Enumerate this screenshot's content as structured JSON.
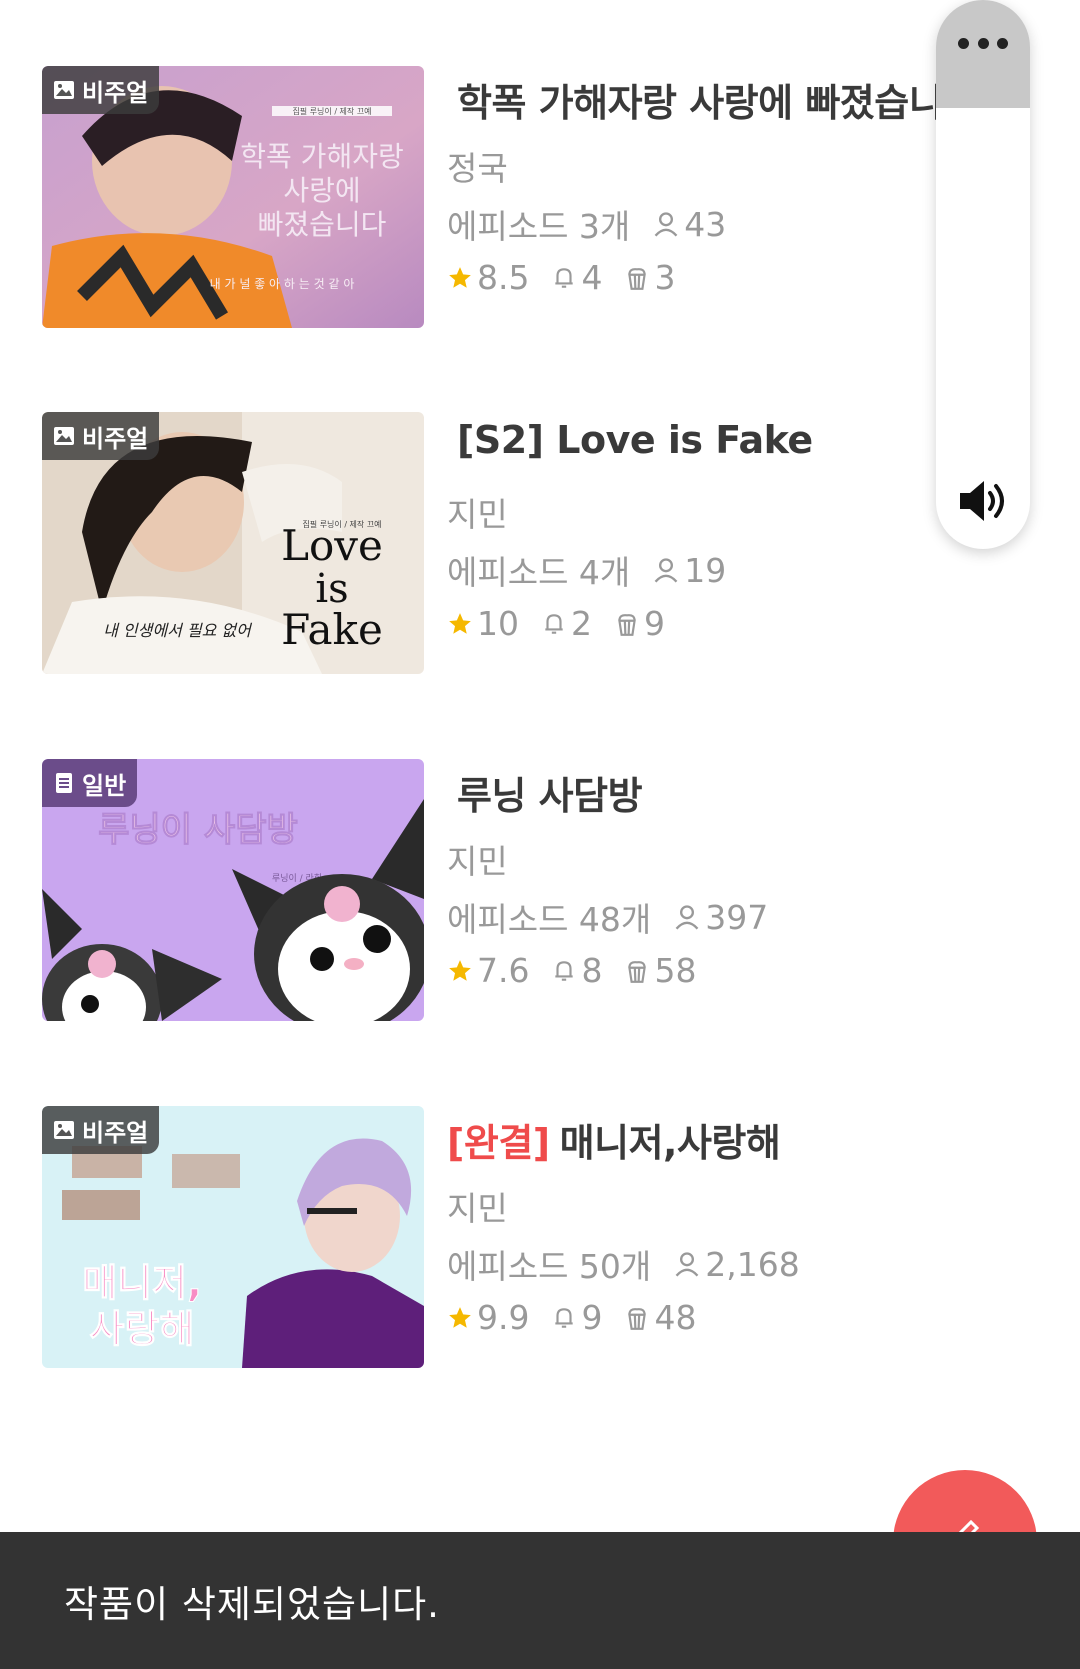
{
  "works": [
    {
      "type_badge": "비주얼",
      "tag": "",
      "title": "학폭 가해자랑 사랑에 빠졌습니다",
      "author": "정국",
      "episodes": "에피소드 3개",
      "readers": "43",
      "rating": "8.5",
      "subscribers": "4",
      "gifts": "3",
      "cover": {
        "small_line": "집필 루닝이 / 제작 끄예",
        "line1": "학폭 가해자랑",
        "line2": "사랑에",
        "line3": "빠졌습니다",
        "footer": "내 가 널 좋 아 하 는 것 같 아"
      }
    },
    {
      "type_badge": "비주얼",
      "tag": "",
      "title": "[S2] Love is Fake",
      "author": "지민",
      "episodes": "에피소드 4개",
      "readers": "19",
      "rating": "10",
      "subscribers": "2",
      "gifts": "9",
      "cover": {
        "small_line": "집필 루닝이 / 제작 끄예",
        "line1": "Love",
        "line2": "is",
        "line3": "Fake",
        "footer": "내 인생에서 필요 없어"
      }
    },
    {
      "type_badge": "일반",
      "tag": "",
      "title": "루닝 사담방",
      "author": "지민",
      "episodes": "에피소드 48개",
      "readers": "397",
      "rating": "7.6",
      "subscribers": "8",
      "gifts": "58",
      "cover": {
        "line1": "루닝이 사담방",
        "small_line": "루닝이 / 라희"
      }
    },
    {
      "type_badge": "비주얼",
      "tag": "[완결]",
      "title": "매니저,사랑해",
      "author": "지민",
      "episodes": "에피소드 50개",
      "readers": "2,168",
      "rating": "9.9",
      "subscribers": "9",
      "gifts": "48",
      "cover": {
        "line1": "매니저,",
        "line2": "사랑해"
      }
    }
  ],
  "toast": {
    "message": "작품이 삭제되었습니다."
  },
  "colors": {
    "accent_red": "#ef4b4b",
    "fab": "#f25a5a",
    "star": "#f5b800",
    "toast_bg": "#333333"
  },
  "icons": {
    "visual_badge": "image-icon",
    "general_badge": "document-icon",
    "readers": "person-icon",
    "rating": "star-icon",
    "subscribers": "bell-icon",
    "gifts": "popcorn-icon",
    "panel_menu": "more-dots-icon",
    "panel_sound": "speaker-icon",
    "fab": "pencil-icon"
  }
}
